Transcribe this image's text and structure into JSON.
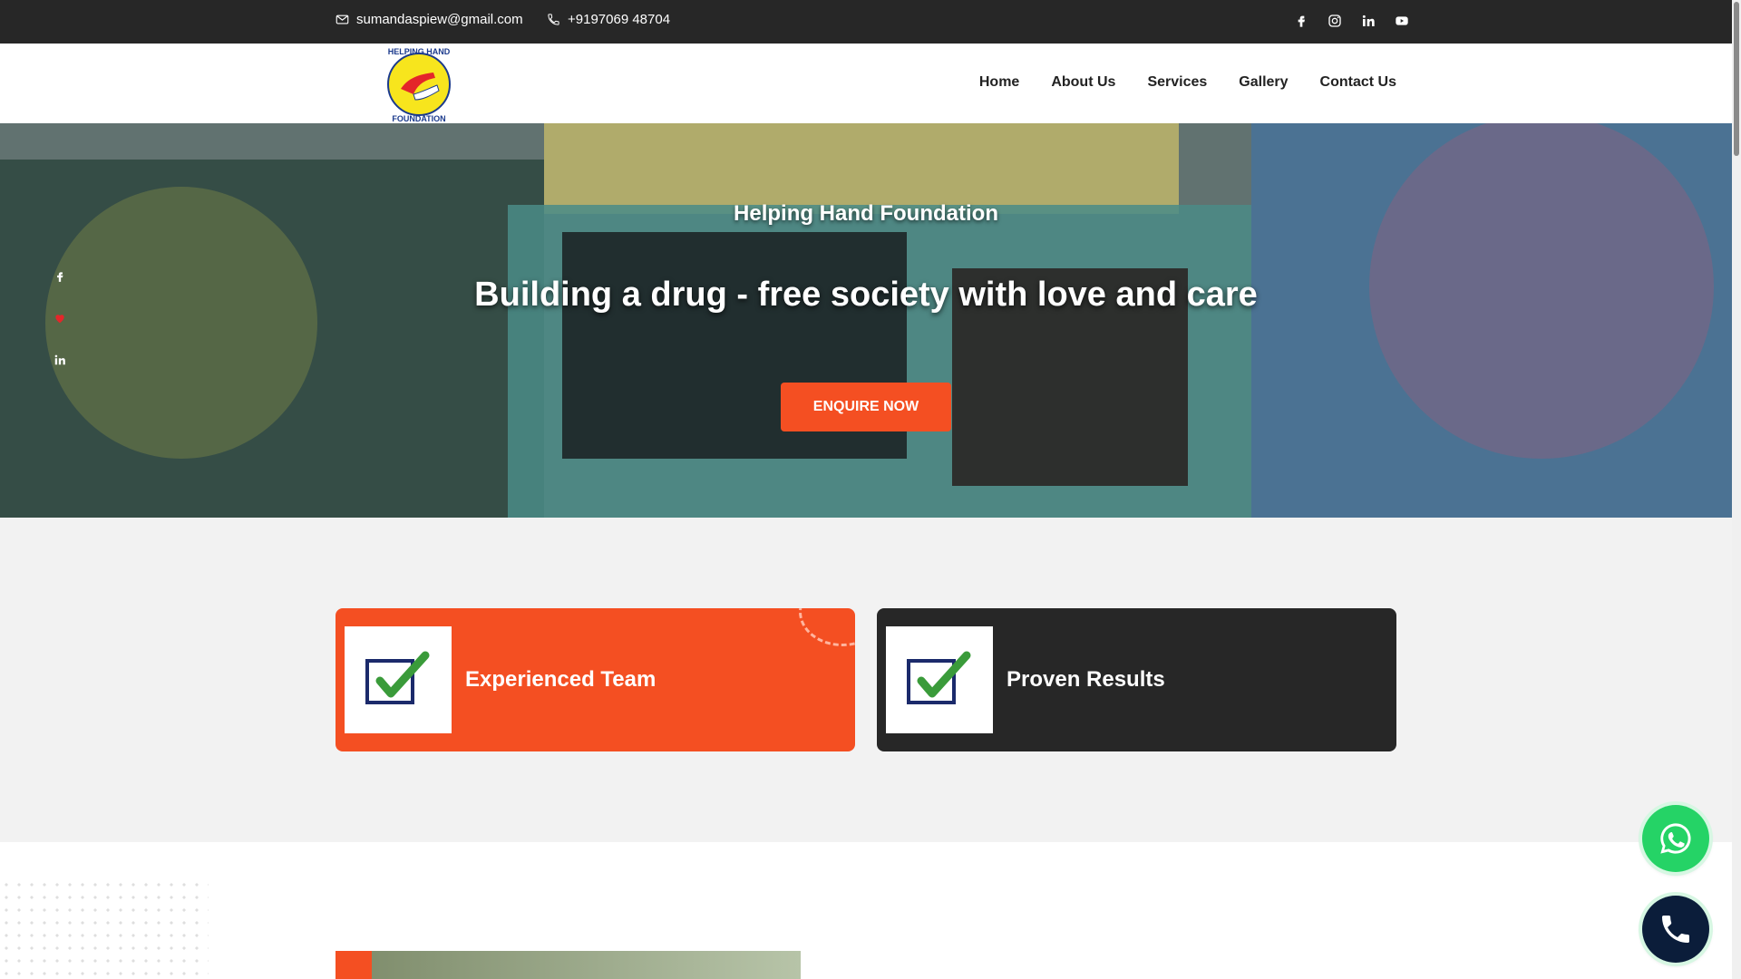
{
  "topbar": {
    "email": "sumandaspiew@gmail.com",
    "phone": "+9197069 48704",
    "social_icons": [
      "facebook-icon",
      "instagram-icon",
      "linkedin-icon",
      "youtube-icon"
    ]
  },
  "nav": {
    "items": [
      "Home",
      "About Us",
      "Services",
      "Gallery",
      "Contact Us"
    ]
  },
  "hero": {
    "title": "Helping Hand Foundation",
    "subtitle": "Building a drug - free society with love and care",
    "cta": "ENQUIRE NOW"
  },
  "features": [
    {
      "label": "Experienced Team",
      "icon": "checkbox-check-icon"
    },
    {
      "label": "Proven Results",
      "icon": "checkbox-check-icon"
    }
  ],
  "colors": {
    "accent": "#f44f22",
    "dark": "#272727",
    "whatsapp": "#25d366",
    "call": "#0b1d3a"
  }
}
